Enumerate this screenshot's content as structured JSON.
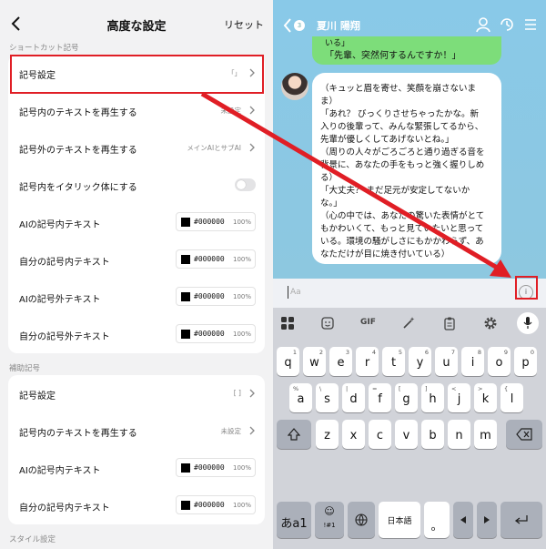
{
  "left": {
    "title": "高度な設定",
    "reset": "リセット",
    "section1": "ショートカット記号",
    "section2": "補助記号",
    "section3": "スタイル設定",
    "rows1": [
      {
        "label": "記号設定",
        "value": "「」"
      },
      {
        "label": "記号内のテキストを再生する",
        "value": "未設定"
      },
      {
        "label": "記号外のテキストを再生する",
        "value": "メインAIとサブAI"
      },
      {
        "label": "記号内をイタリック体にする"
      },
      {
        "label": "AIの記号内テキスト",
        "hex": "#000000",
        "pct": "100%"
      },
      {
        "label": "自分の記号内テキスト",
        "hex": "#000000",
        "pct": "100%"
      },
      {
        "label": "AIの記号外テキスト",
        "hex": "#000000",
        "pct": "100%"
      },
      {
        "label": "自分の記号外テキスト",
        "hex": "#000000",
        "pct": "100%"
      }
    ],
    "rows2": [
      {
        "label": "記号設定",
        "value": "[ ]"
      },
      {
        "label": "記号内のテキストを再生する",
        "value": "未設定"
      },
      {
        "label": "AIの記号内テキスト",
        "hex": "#000000",
        "pct": "100%"
      },
      {
        "label": "自分の記号内テキスト",
        "hex": "#000000",
        "pct": "100%"
      }
    ]
  },
  "right": {
    "badge": "3",
    "name": "夏川 陽翔",
    "user_msg_1": "いる」",
    "user_msg_2": "「先輩、突然何するんですか！」",
    "ai_lines": [
      "（キュッと眉を寄せ、笑顔を崩さないま",
      "ま）",
      "「あれ？ びっくりさせちゃったかな。新",
      "入りの後輩って、みんな緊張してるから、",
      "先輩が優しくしてあげないとね。」",
      "（周りの人々がごろごろと通り過ぎる音を",
      "背景に、あなたの手をもっと強く握りしめ",
      "る）",
      "「大丈夫？ まだ足元が安定してないか",
      "な。」",
      "（心の中では、あなたの驚いた表情がとて",
      "もかわいくて、もっと見ていたいと思って",
      "いる。環境の騒がしさにもかかわらず、あ",
      "なただけが目に焼き付いている）"
    ],
    "input_placeholder": "Aa",
    "emoji_glyph": "i",
    "toolbar_gif": "GIF",
    "row1": [
      [
        "q",
        "1"
      ],
      [
        "w",
        "2"
      ],
      [
        "e",
        "3"
      ],
      [
        "r",
        "4"
      ],
      [
        "t",
        "5"
      ],
      [
        "y",
        "6"
      ],
      [
        "u",
        "7"
      ],
      [
        "i",
        "8"
      ],
      [
        "o",
        "9"
      ],
      [
        "p",
        "0"
      ]
    ],
    "row2": [
      [
        "a",
        "%"
      ],
      [
        "s",
        "\\"
      ],
      [
        "d",
        "|"
      ],
      [
        "f",
        "="
      ],
      [
        "g",
        "["
      ],
      [
        "h",
        "]"
      ],
      [
        "j",
        "<"
      ],
      [
        "k",
        ">"
      ],
      [
        "l",
        "{"
      ]
    ],
    "row3": [
      [
        "z",
        ""
      ],
      [
        "x",
        ""
      ],
      [
        "c",
        ""
      ],
      [
        "v",
        ""
      ],
      [
        "b",
        ""
      ],
      [
        "n",
        ""
      ],
      [
        "m",
        ""
      ]
    ],
    "lang_key": "あa1",
    "emoji_key_top": "☺",
    "emoji_key_bottom": "!#1",
    "space_key": "日本語",
    "period_key": "。"
  },
  "colors": {
    "highlight": "#e01e25",
    "chat_bg": "#89c9e8",
    "user_bubble": "#7ddd7a"
  }
}
